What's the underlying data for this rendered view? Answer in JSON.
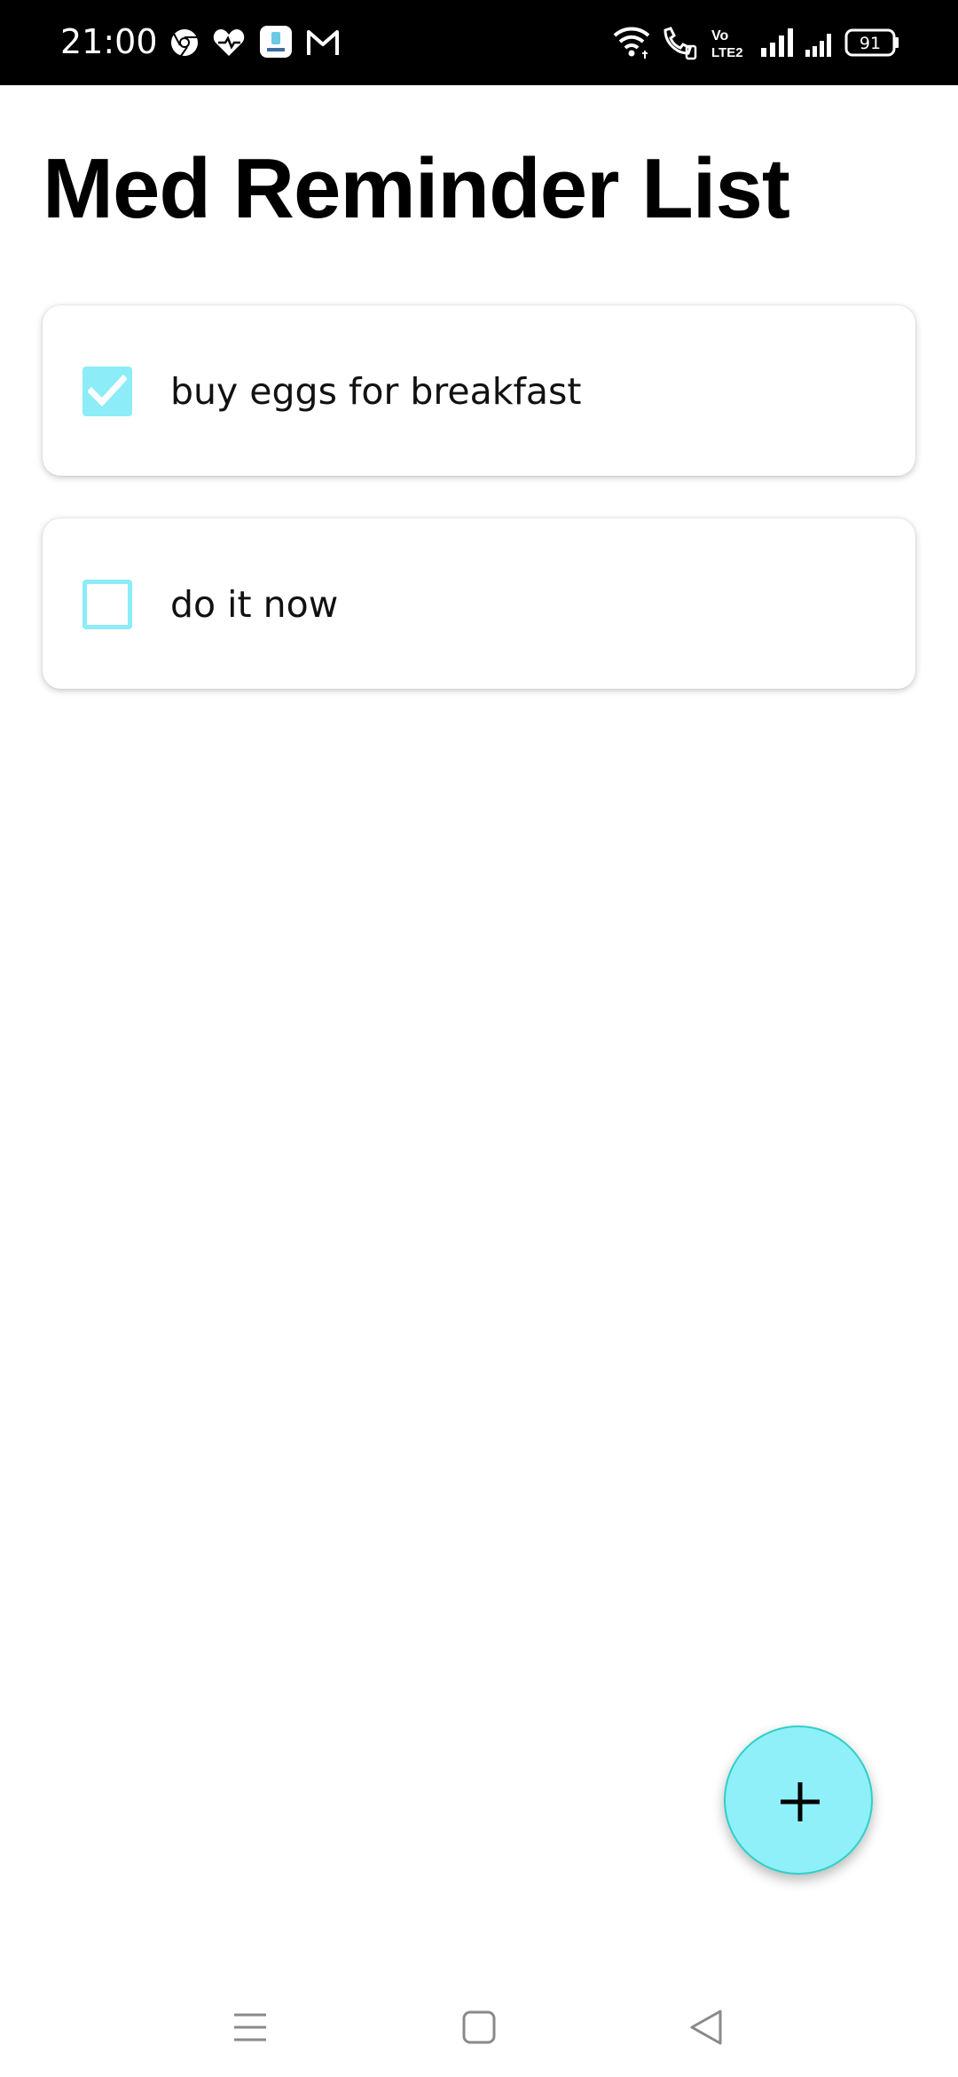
{
  "status_bar": {
    "time": "21:00",
    "battery": "91",
    "network_badge_top": "Vo",
    "network_badge_bottom": "LTE2",
    "icons": [
      "chrome-icon",
      "heart-icon",
      "app-icon",
      "gmail-icon",
      "wifi-icon",
      "wifi-calling-icon",
      "volte-icon",
      "signal-icon",
      "signal-icon-2",
      "battery-icon"
    ]
  },
  "header": {
    "title": "Med Reminder List"
  },
  "tasks": [
    {
      "label": "buy eggs for breakfast",
      "checked": true
    },
    {
      "label": "do it now",
      "checked": false
    }
  ],
  "fab": {
    "icon": "plus-icon"
  },
  "nav_bar": {
    "icons": [
      "menu-icon",
      "home-icon",
      "back-icon"
    ]
  },
  "colors": {
    "accent": "#8cecf7",
    "fab": "#8ff0fa",
    "fab_border": "#2fd0c8",
    "status_bar": "#000000"
  }
}
